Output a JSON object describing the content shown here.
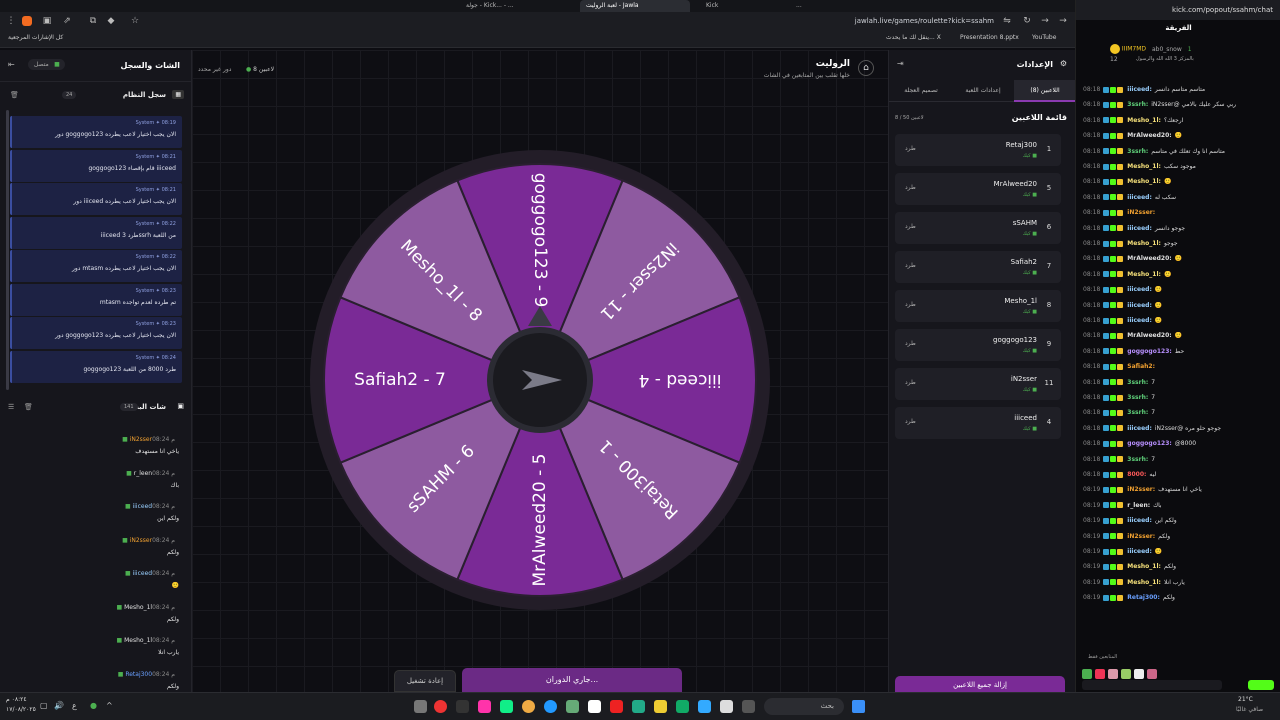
{
  "browser": {
    "tabs": [
      {
        "label": "جولة - Kick... - ...",
        "active": false
      },
      {
        "label": "Kick",
        "active": false
      },
      {
        "label": "لعبة الروليت - Jawla",
        "active": true
      },
      {
        "label": "...",
        "active": false
      }
    ],
    "url": "jawlah.live/games/roulette?kick=ssahm",
    "bookmarks": {
      "all": "كل الإشارات المرجعية",
      "x": "ينقل لك ما يحدث... X",
      "presentation": "Presentation 8.pptx",
      "youtube": "YouTube"
    }
  },
  "left": {
    "title": "الشات والسجل",
    "connected": "متصل",
    "log_title": "سجل النظام",
    "log_count": "24",
    "log": [
      {
        "meta": "System ✦ 08:19",
        "text": "دور goggogo123 الان يجب اختيار لاعب يطرده"
      },
      {
        "meta": "System ✦ 08:21",
        "text": "goggogo123 قام بإقصاء iiiceed"
      },
      {
        "meta": "System ✦ 08:21",
        "text": "دور iiiceed الان يجب اختيار لاعب يطرده"
      },
      {
        "meta": "System ✦ 08:22",
        "text": "iiiceed طرد 3ssrh من اللعبة"
      },
      {
        "meta": "System ✦ 08:22",
        "text": "دور mtasm الان يجب اختيار لاعب يطرده"
      },
      {
        "meta": "System ✦ 08:23",
        "text": "mtasm تم طرده لعدم تواجده"
      },
      {
        "meta": "System ✦ 08:23",
        "text": "دور goggogo123 الان يجب اختيار لاعب يطرده"
      },
      {
        "meta": "System ✦ 08:24",
        "text": "goggogo123 طرد 8000 من اللعبة"
      }
    ],
    "chat_title": "شات البث",
    "chat_count": "141",
    "chat": [
      {
        "user": "iN2sser",
        "time": "08:24 م",
        "msg": "ياخي انا مستهدف",
        "color": "#f0a030"
      },
      {
        "user": "r_leen",
        "time": "08:24 م",
        "msg": "باك",
        "color": "#e0e0e0"
      },
      {
        "user": "iiiceed",
        "time": "08:24 م",
        "msg": "ولكم اين",
        "color": "#9ad0ff"
      },
      {
        "user": "iN2sser",
        "time": "08:24 م",
        "msg": "ولكم",
        "color": "#f0a030"
      },
      {
        "user": "iiiceed",
        "time": "08:24 م",
        "msg": "🙂",
        "color": "#9ad0ff"
      },
      {
        "user": "Mesho_1l",
        "time": "08:24 م",
        "msg": "ولكم",
        "color": "#e0e0e0"
      },
      {
        "user": "Mesho_1l",
        "time": "08:24 م",
        "msg": "يارب انلا",
        "color": "#e0e0e0"
      },
      {
        "user": "Retaj300",
        "time": "08:24 م",
        "msg": "ولكم",
        "color": "#6aa0ff"
      }
    ]
  },
  "main": {
    "title": "الروليت",
    "subtitle": "خلها تقلب بين المتابعين في الشات",
    "players_online": "8 لاعبين",
    "mode": "دور غير محدد",
    "wheel": [
      {
        "label": "goggogo123 - 9",
        "color": "#7a2a96"
      },
      {
        "label": "iN2sser - 11",
        "color": "#8e5aa0"
      },
      {
        "label": "iiiceed - 4",
        "color": "#7a2a96"
      },
      {
        "label": "Retaj300 - 1",
        "color": "#8e5aa0"
      },
      {
        "label": "MrAlweed20 - 5",
        "color": "#7a2a96"
      },
      {
        "label": "sSAHM - 6",
        "color": "#8e5aa0"
      },
      {
        "label": "Safiah2 - 7",
        "color": "#7a2a96"
      },
      {
        "label": "Mesho_1l - 8",
        "color": "#8e5aa0"
      }
    ],
    "spin_button": "جاري الدوران...",
    "replay_button": "إعادة تشغيل"
  },
  "right": {
    "title": "الإعدادات",
    "tabs": [
      "اللاعبين (8)",
      "إعدادات اللعبة",
      "تصميم العجلة"
    ],
    "list_title": "قائمة اللاعبين",
    "list_count": "8 / 50 لاعبين",
    "kick_label": "طرد",
    "sub_label": "كيك",
    "players": [
      {
        "name": "Retaj300",
        "idx": "1"
      },
      {
        "name": "MrAlweed20",
        "idx": "5"
      },
      {
        "name": "sSAHM",
        "idx": "6"
      },
      {
        "name": "Safiah2",
        "idx": "7"
      },
      {
        "name": "Mesho_1l",
        "idx": "8"
      },
      {
        "name": "goggogo123",
        "idx": "9"
      },
      {
        "name": "iN2sser",
        "idx": "11"
      },
      {
        "name": "iiiceed",
        "idx": "4"
      }
    ],
    "remove_all": "إزالة جميع اللاعبين"
  },
  "kick": {
    "url": "kick.com/popout/ssahm/chat",
    "title": "الفريقة",
    "top_users": [
      {
        "name": "IIIM7MD",
        "score": "12"
      },
      {
        "name": "ab0_snow",
        "score": "1"
      }
    ],
    "pinned": "بالمزكز 3 الله الله والرسول",
    "messages": [
      {
        "t": "08:18",
        "u": "iiiceed",
        "m": "متاسم متاسم دانسر",
        "c": "#9ad0ff"
      },
      {
        "t": "08:18",
        "u": "3ssrh",
        "m": "iN2sser@ ربي سكر عليك بالامي",
        "c": "#5fd07a"
      },
      {
        "t": "08:18",
        "u": "Mesho_1l",
        "m": "ارجعك؟",
        "c": "#f5e07a"
      },
      {
        "t": "08:18",
        "u": "MrAlweed20",
        "m": "🙂",
        "c": "#e0e0e0"
      },
      {
        "t": "08:18",
        "u": "3ssrh",
        "m": "متاسم انا وك تعلك في متاسم",
        "c": "#5fd07a"
      },
      {
        "t": "08:18",
        "u": "Mesho_1l",
        "m": "موجود سكب",
        "c": "#f5e07a"
      },
      {
        "t": "08:18",
        "u": "Mesho_1l",
        "m": "🙂",
        "c": "#f5e07a"
      },
      {
        "t": "08:18",
        "u": "iiiceed",
        "m": "سكب له",
        "c": "#9ad0ff"
      },
      {
        "t": "08:18",
        "u": "iN2sser",
        "m": "",
        "c": "#f0a030"
      },
      {
        "t": "08:18",
        "u": "iiiceed",
        "m": "جوجو دانسر",
        "c": "#9ad0ff"
      },
      {
        "t": "08:18",
        "u": "Mesho_1l",
        "m": "جوجو",
        "c": "#f5e07a"
      },
      {
        "t": "08:18",
        "u": "MrAlweed20",
        "m": "🙂",
        "c": "#e0e0e0"
      },
      {
        "t": "08:18",
        "u": "Mesho_1l",
        "m": "🙂",
        "c": "#f5e07a"
      },
      {
        "t": "08:18",
        "u": "iiiceed",
        "m": "🙂",
        "c": "#9ad0ff"
      },
      {
        "t": "08:18",
        "u": "iiiceed",
        "m": "🙂",
        "c": "#9ad0ff"
      },
      {
        "t": "08:18",
        "u": "iiiceed",
        "m": "🙂",
        "c": "#9ad0ff"
      },
      {
        "t": "08:18",
        "u": "MrAlweed20",
        "m": "🙂",
        "c": "#e0e0e0"
      },
      {
        "t": "08:18",
        "u": "goggogo123",
        "m": "حط",
        "c": "#b890ff"
      },
      {
        "t": "08:18",
        "u": "Safiah2",
        "m": "",
        "c": "#f0a030"
      },
      {
        "t": "08:18",
        "u": "3ssrh",
        "m": "7",
        "c": "#5fd07a"
      },
      {
        "t": "08:18",
        "u": "3ssrh",
        "m": "7",
        "c": "#5fd07a"
      },
      {
        "t": "08:18",
        "u": "3ssrh",
        "m": "7",
        "c": "#5fd07a"
      },
      {
        "t": "08:18",
        "u": "iiiceed",
        "m": "iN2sser@ جوجو حلو مره",
        "c": "#9ad0ff"
      },
      {
        "t": "08:18",
        "u": "goggogo123",
        "m": "@8000",
        "c": "#b890ff"
      },
      {
        "t": "08:18",
        "u": "3ssrh",
        "m": "7",
        "c": "#5fd07a"
      },
      {
        "t": "08:18",
        "u": "8000",
        "m": "ليه",
        "c": "#ff5a5a"
      },
      {
        "t": "08:19",
        "u": "iN2sser",
        "m": "ياخي انا مستهدف",
        "c": "#f0a030"
      },
      {
        "t": "08:19",
        "u": "r_leen",
        "m": "باك",
        "c": "#e0e0e0"
      },
      {
        "t": "08:19",
        "u": "iiiceed",
        "m": "ولكم اين",
        "c": "#9ad0ff"
      },
      {
        "t": "08:19",
        "u": "iN2sser",
        "m": "ولكم",
        "c": "#f0a030"
      },
      {
        "t": "08:19",
        "u": "iiiceed",
        "m": "🙂",
        "c": "#9ad0ff"
      },
      {
        "t": "08:19",
        "u": "Mesho_1l",
        "m": "ولكم",
        "c": "#f5e07a"
      },
      {
        "t": "08:19",
        "u": "Mesho_1l",
        "m": "يارب انلا",
        "c": "#f5e07a"
      },
      {
        "t": "08:19",
        "u": "Retaj300",
        "m": "ولكم",
        "c": "#6aa0ff"
      }
    ],
    "paused": "المتابعين فقط"
  },
  "taskbar": {
    "date": "١٧/٠٨/٢٠٢٥",
    "time": "٠٨:٢٤ م",
    "search": "بحث",
    "weather": "21°C",
    "weather_desc": "صافي غالبًا",
    "lang": "ع"
  }
}
